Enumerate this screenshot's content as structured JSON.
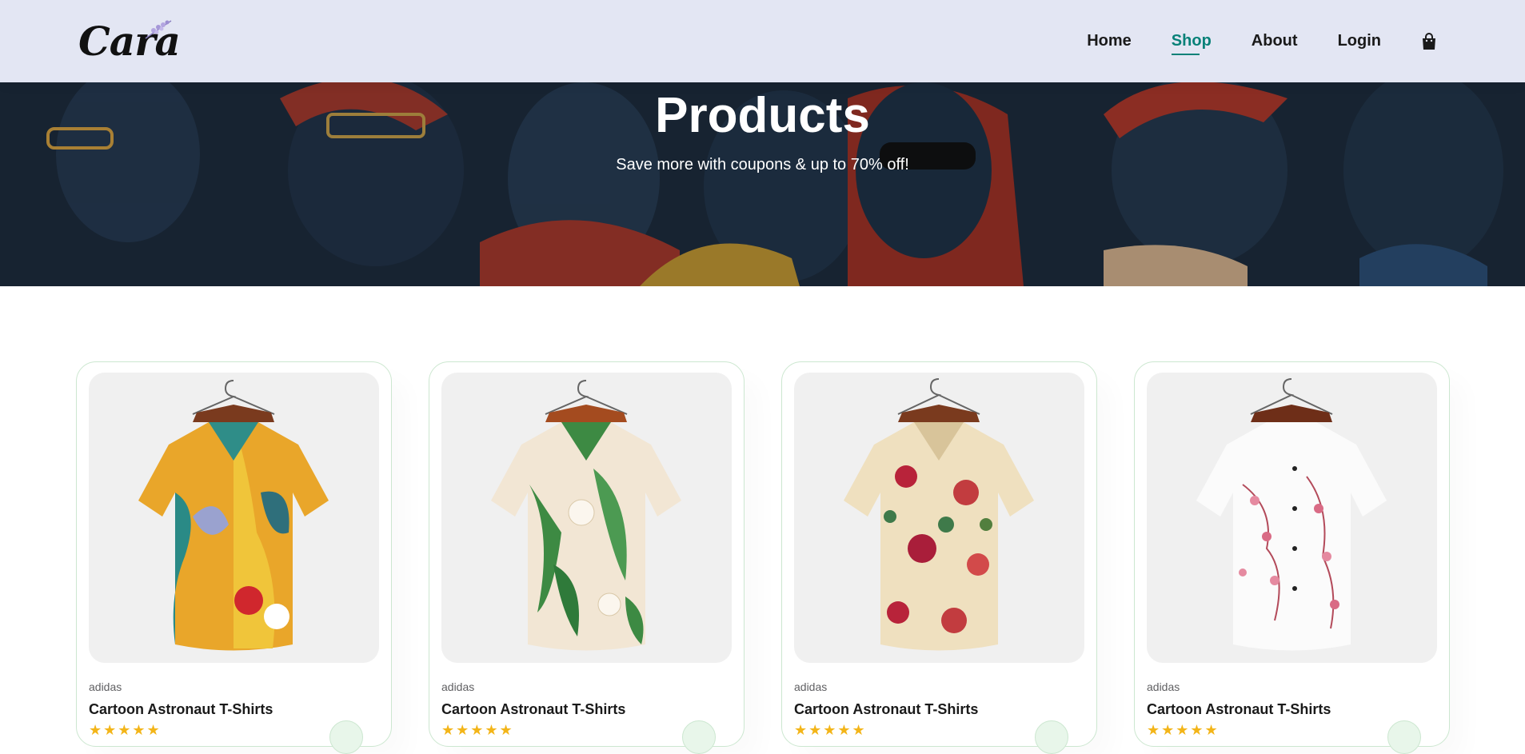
{
  "header": {
    "logo_text": "Cara",
    "nav": [
      {
        "label": "Home",
        "active": false
      },
      {
        "label": "Shop",
        "active": true
      },
      {
        "label": "About",
        "active": false
      },
      {
        "label": "Login",
        "active": false
      }
    ],
    "cart_icon": "shopping-bag-icon",
    "accent_color": "#088178"
  },
  "hero": {
    "title": "Products",
    "subtitle": "Save more with coupons & up to 70% off!"
  },
  "products": [
    {
      "brand": "adidas",
      "name": "Cartoon Astronaut T-Shirts",
      "rating": 5,
      "image": "colorful-abstract-print-shirt"
    },
    {
      "brand": "adidas",
      "name": "Cartoon Astronaut T-Shirts",
      "rating": 5,
      "image": "white-lily-leaf-print-shirt"
    },
    {
      "brand": "adidas",
      "name": "Cartoon Astronaut T-Shirts",
      "rating": 5,
      "image": "cream-rose-floral-print-shirt"
    },
    {
      "brand": "adidas",
      "name": "Cartoon Astronaut T-Shirts",
      "rating": 5,
      "image": "white-pink-blossom-print-shirt"
    }
  ]
}
